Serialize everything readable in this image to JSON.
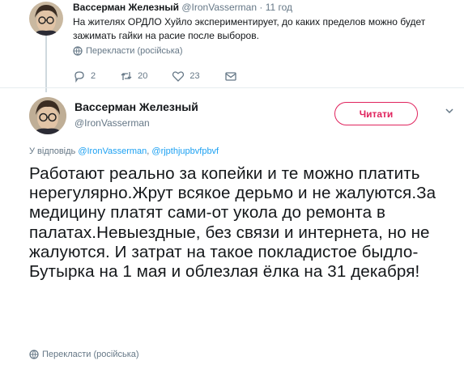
{
  "parent_tweet": {
    "name": "Вассерман Железный",
    "handle": "@IronVasserman",
    "separator": "·",
    "time": "11 год",
    "text": "На жителях ОРДЛО Хуйло экспериментирует, до каких пределов можно будет зажимать гайки на расие после выборов.",
    "translate_label": "Перекласти (російська)",
    "counts": {
      "replies": "2",
      "retweets": "20",
      "likes": "23"
    }
  },
  "main_tweet": {
    "name": "Вассерман Железный",
    "handle": "@IronVasserman",
    "follow_label": "Читати",
    "reply_prefix": "У відповідь",
    "reply_to_1": "@IronVasserman",
    "reply_sep": ",",
    "reply_to_2": "@rjpthjupbvfpbvf",
    "text": "Работают реально за копейки и те можно платить нерегулярно.Жрут всякое дерьмо и не жалуются.За медицину платят сами-от укола до ремонта в палатах.Невыездные, без связи и интернета, но не жалуются. И затрат на такое покладистое быдло-Бутырка на 1 мая и облезлая ёлка на 31 декабря!",
    "translate_label": "Перекласти (російська)"
  },
  "colors": {
    "accent": "#e0245e",
    "link": "#1da1f2",
    "muted": "#657786",
    "text": "#14171a"
  },
  "icons": [
    "globe-icon",
    "reply-icon",
    "retweet-icon",
    "like-icon",
    "dm-icon",
    "chevron-down-icon",
    "avatar"
  ]
}
